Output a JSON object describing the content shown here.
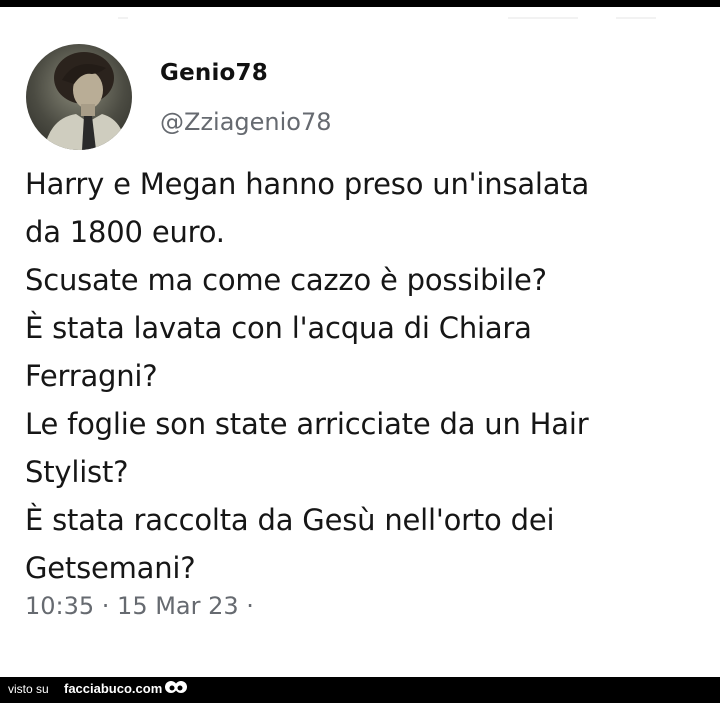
{
  "tweet": {
    "author_name": "Genio78",
    "author_handle": "@Zziagenio78",
    "lines": [
      "Harry e Megan hanno preso un'insalata",
      "da 1800 euro.",
      "Scusate ma come cazzo è possibile?",
      "È stata lavata con l'acqua di Chiara",
      "Ferragni?",
      "Le foglie son state arricciate da un Hair",
      "Stylist?",
      "È stata raccolta da Gesù nell'orto dei",
      "Getsemani?"
    ],
    "timestamp": "10:35 · 15 Mar 23 ·"
  },
  "footer": {
    "seen_on": "visto su",
    "site": "facciabuco.com"
  },
  "icons": {
    "avatar": "profile-photo",
    "logo": "eyes-logo-icon"
  }
}
